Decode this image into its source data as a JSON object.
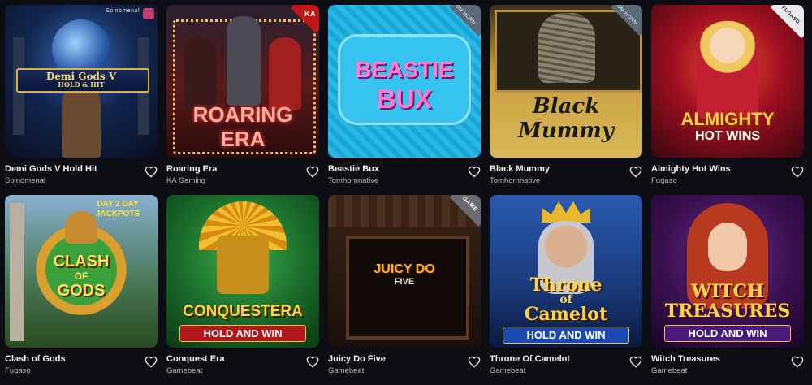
{
  "games": [
    {
      "name": "Demi Gods V Hold Hit",
      "provider": "Spinomenal",
      "art_title": "Demi Gods V",
      "art_sub": "HOLD & HIT",
      "corner": "Spinomenal",
      "accent": "#1a3a6e"
    },
    {
      "name": "Roaring Era",
      "provider": "KA Gaming",
      "art_title": "ROARING",
      "art_title2": "ERA",
      "corner": "KA",
      "accent": "#8a1e1e"
    },
    {
      "name": "Beastie Bux",
      "provider": "Tomhornnative",
      "art_title": "BEASTIE",
      "art_title2": "BUX",
      "corner": "TOM HORN",
      "accent": "#1aa6d6"
    },
    {
      "name": "Black Mummy",
      "provider": "Tomhornnative",
      "art_title": "Black",
      "art_title2": "Mummy",
      "corner": "TOM HORN",
      "accent": "#c9a040"
    },
    {
      "name": "Almighty Hot Wins",
      "provider": "Fugaso",
      "art_title": "ALMIGHTY",
      "art_title2": "HOT WINS",
      "corner": "FUGASO",
      "accent": "#b8142a"
    },
    {
      "name": "Clash of Gods",
      "provider": "Fugaso",
      "art_title": "CLASH",
      "art_title_of": "OF",
      "art_title2": "GODS",
      "art_badge": "DAY 2 DAY JACKPOTS",
      "accent": "#3a7a2a"
    },
    {
      "name": "Conquest Era",
      "provider": "Gamebeat",
      "art_title": "CONQUESTERA",
      "art_sub": "HOLD AND WIN",
      "accent": "#2a8a3a"
    },
    {
      "name": "Juicy Do Five",
      "provider": "Gamebeat",
      "art_title": "JUICY DO",
      "art_title2": "FIVE",
      "corner": "GAME",
      "accent": "#2a1a10"
    },
    {
      "name": "Throne Of Camelot",
      "provider": "Gamebeat",
      "art_title": "Throne",
      "art_title_of": "of",
      "art_title2": "Camelot",
      "art_sub": "HOLD AND WIN",
      "accent": "#1e5aa8"
    },
    {
      "name": "Witch Treasures",
      "provider": "Gamebeat",
      "art_title": "WITCH",
      "art_title2": "TREASURES",
      "art_sub": "HOLD AND WIN",
      "accent": "#4a1a6e"
    }
  ]
}
